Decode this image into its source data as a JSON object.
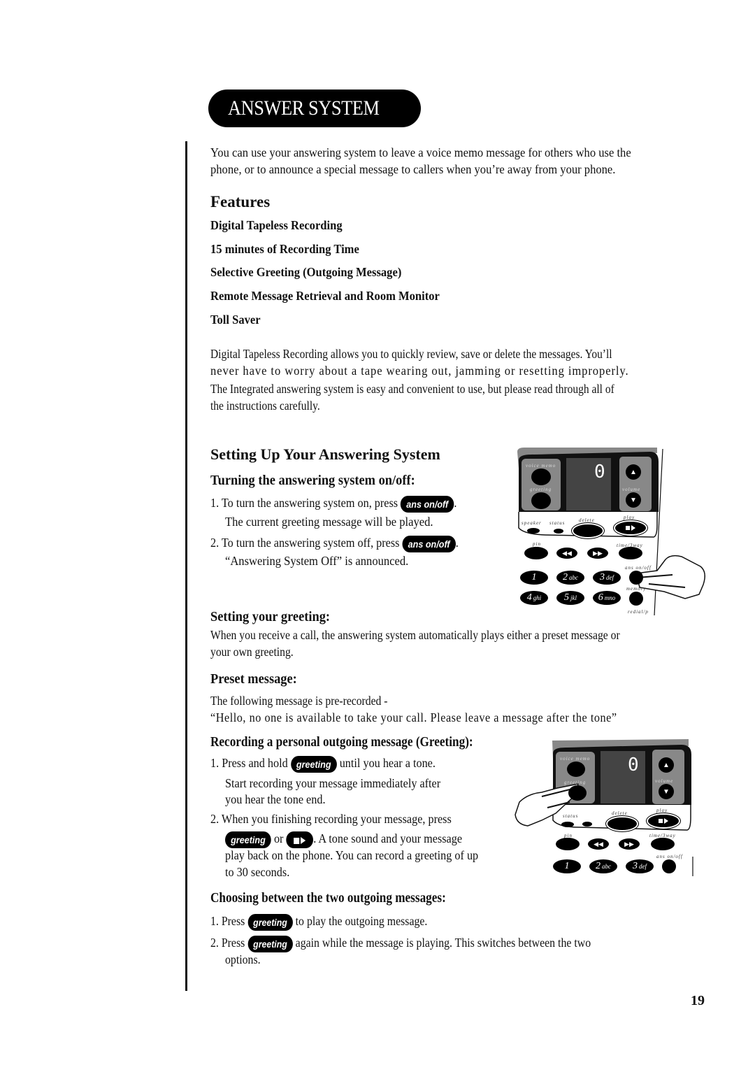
{
  "header": {
    "title": "ANSWER SYSTEM"
  },
  "intro": "You can use your answering system to leave a voice memo message for others who use the phone, or to announce a special message to callers when you’re away from your phone.",
  "intro_lines": [
    "You can use your answering system to leave a voice memo message for others who use the",
    "phone, or to announce a special message to callers when you’re away from your phone."
  ],
  "features": {
    "heading": "Features",
    "items": [
      "Digital Tapeless Recording",
      "15 minutes of Recording Time",
      "Selective Greeting (Outgoing Message)",
      "Remote Message Retrieval and Room Monitor",
      "Toll Saver"
    ],
    "para1_lines": [
      "Digital Tapeless Recording allows you to quickly review, save or delete the messages. You’ll",
      "never have to worry about a tape wearing out, jamming or resetting improperly."
    ],
    "para2_lines": [
      "The Integrated answering system is easy and convenient to use, but please read through all of",
      "the instructions carefully."
    ]
  },
  "setup": {
    "heading": "Setting Up Your Answering System",
    "onoff": {
      "heading": "Turning the answering system on/off:",
      "step1_a": "1.  To turn the answering system on, press",
      "step1_b": ".",
      "step1_c": "The current greeting message will be played.",
      "step2_a": "2.  To turn the answering system off, press",
      "step2_b": ".",
      "step2_c": "“Answering System Off” is announced."
    },
    "button_ans": "ans on/off",
    "button_greeting": "greeting"
  },
  "greeting": {
    "heading": "Setting your greeting:",
    "lines": [
      "When you receive a call, the answering system automatically plays either a preset message or",
      "your own greeting."
    ]
  },
  "preset": {
    "heading": "Preset message:",
    "line1": "The following message is pre-recorded -",
    "line2": "“Hello, no one is available to take your call. Please leave a message after the tone”"
  },
  "recording": {
    "heading": "Recording a personal outgoing message (Greeting):",
    "s1_a": "1.  Press and hold",
    "s1_b": "until you hear a tone.",
    "s1_c": "Start recording your message immediately after",
    "s1_d": "you hear the tone end.",
    "s2_a": "2.  When you finishing recording your message, press",
    "s2_or": "or",
    "s2_b": ". A tone sound and your message",
    "s2_c": "play back on the phone. You can record a greeting of up",
    "s2_d": "to 30 seconds."
  },
  "choosing": {
    "heading": "Choosing between the two outgoing messages:",
    "s1_a": "1.  Press",
    "s1_b": "to play the outgoing message.",
    "s2_a": "2.  Press",
    "s2_b": "again while the message is playing. This switches between the two",
    "s2_c": "options."
  },
  "phone": {
    "display_digit": "0",
    "labels": {
      "voice_memo": "voice memo",
      "greeting": "greeting",
      "volume": "volume",
      "speaker": "speaker",
      "status": "status",
      "delete": "delete",
      "play": "play",
      "pin": "pin",
      "time_3way": "time/3way",
      "ans_onoff": "ans on/off",
      "memory": "memory",
      "redial": "redial/p"
    },
    "keys": [
      {
        "num": "1",
        "letters": ""
      },
      {
        "num": "2",
        "letters": "abc"
      },
      {
        "num": "3",
        "letters": "def"
      },
      {
        "num": "4",
        "letters": "ghi"
      },
      {
        "num": "5",
        "letters": "jkl"
      },
      {
        "num": "6",
        "letters": "mno"
      }
    ]
  },
  "page_number": "19"
}
